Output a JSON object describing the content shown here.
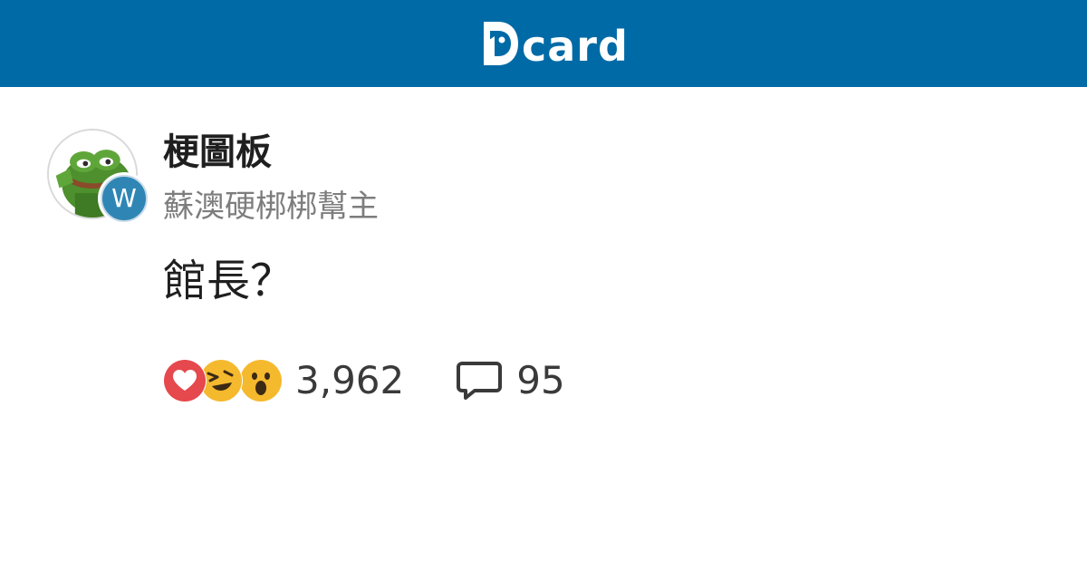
{
  "header": {
    "logo_text": "card",
    "logo_icon": "dcard-d-mark",
    "background_color": "#006aa6"
  },
  "post": {
    "forum_name": "梗圖板",
    "author": "蘇澳硬梆梆幫主",
    "author_badge": "W",
    "avatar_icon": "pepe-frog-avatar",
    "title": "館長？",
    "reactions": [
      "heart-icon",
      "laughing-emoji-icon",
      "surprised-emoji-icon"
    ],
    "reaction_count": "3,962",
    "comment_icon": "comment-bubble-icon",
    "comment_count": "95"
  }
}
